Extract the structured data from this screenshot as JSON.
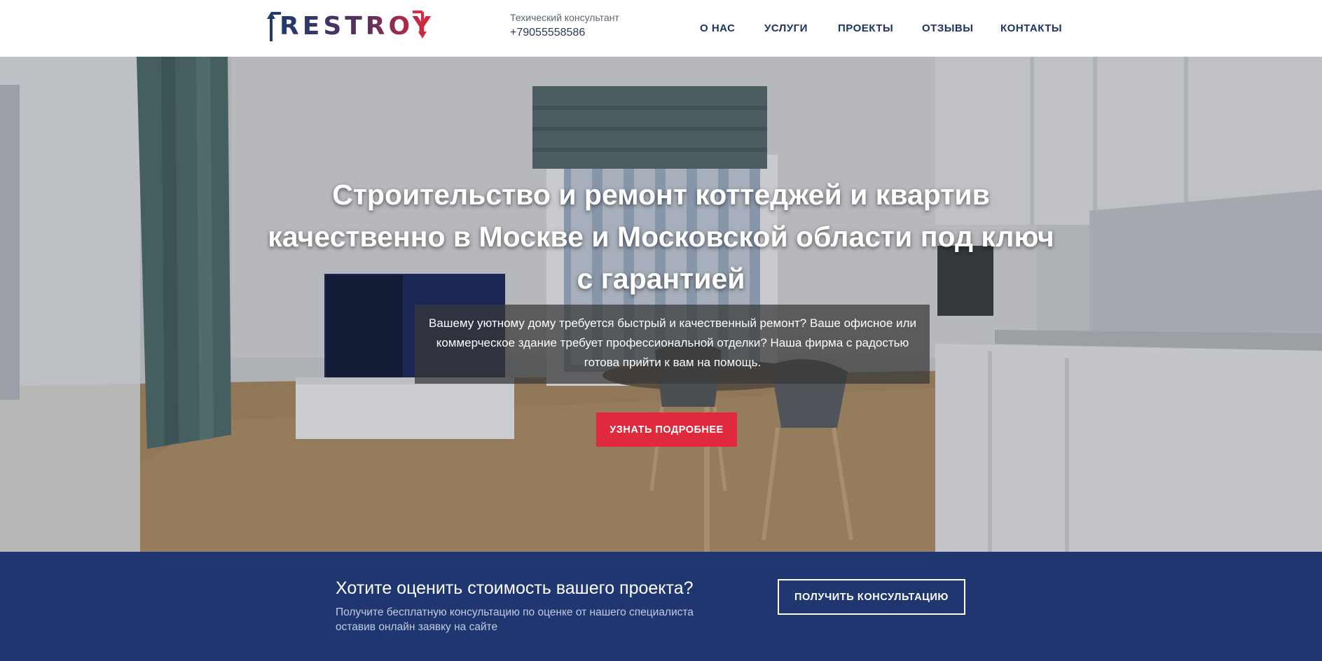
{
  "header": {
    "logo_text": "RESTROY",
    "contact_role": "Техический консультант",
    "contact_phone": "+79055558586",
    "nav": [
      "О НАС",
      "УСЛУГИ",
      "ПРОЕКТЫ",
      "ОТЗЫВЫ",
      "КОНТАКТЫ"
    ]
  },
  "hero": {
    "title": "Строительство и ремонт коттеджей и квартив качественно в Москве и Московской области под ключ с гарантией",
    "text": "Вашему уютному дому требуется быстрый и качественный ремонт? Ваше офисное или коммерческое здание требует профессиональной отделки? Наша фирма с радостью готова прийти к вам на помощь.",
    "button_label": "УЗНАТЬ ПОДРОБНЕЕ"
  },
  "cta": {
    "title": "Хотите оценить стоимость вашего проекта?",
    "subtitle": "Получите бесплатную консультацию по оценке от нашего специалиста оставив онлайн заявку на сайте",
    "button_label": "ПОЛУЧИТЬ КОНСУЛЬТАЦИЮ"
  },
  "colors": {
    "brand_navy": "#1f3670",
    "accent_red": "#e0293c",
    "nav_text": "#1f3264"
  },
  "icons": [
    "logo-arrow-up-icon",
    "logo-arrow-down-icon"
  ]
}
